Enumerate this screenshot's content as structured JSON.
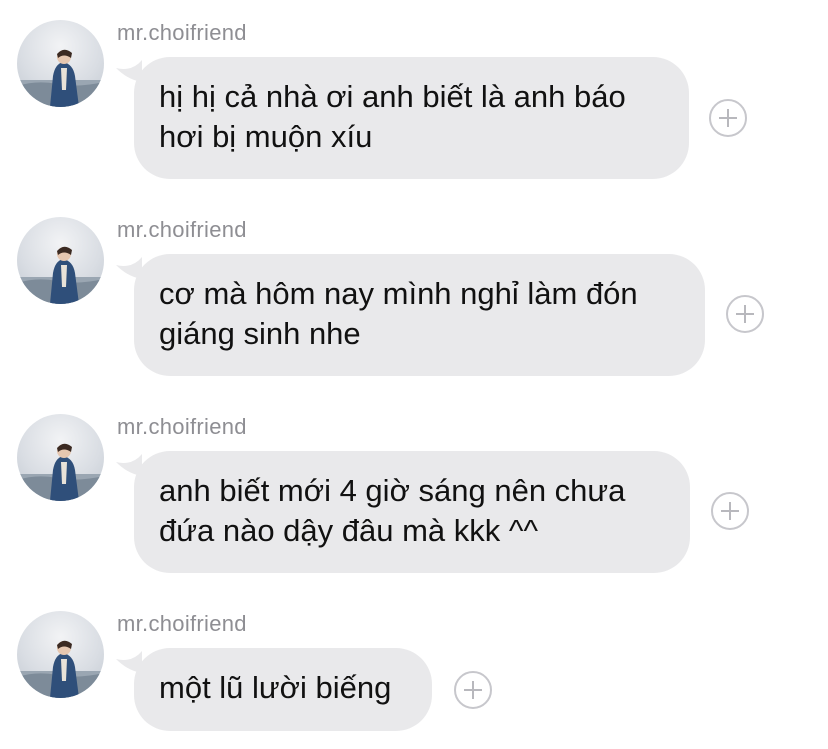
{
  "messages": [
    {
      "sender": "mr.choifriend",
      "lines": [
        "hị hị cả nhà ơi anh biết là anh báo",
        "hơi bị muộn xíu"
      ]
    },
    {
      "sender": "mr.choifriend",
      "lines": [
        "cơ mà hôm nay mình nghỉ làm đón",
        "giáng sinh nhe"
      ]
    },
    {
      "sender": "mr.choifriend",
      "lines": [
        "anh biết mới 4 giờ sáng nên chưa",
        "đứa nào dậy đâu mà kkk ^^"
      ]
    },
    {
      "sender": "mr.choifriend",
      "lines": [
        "một lũ lười biếng"
      ]
    }
  ],
  "icons": {
    "avatar": "avatar-photo",
    "reaction": "add-reaction-plus-icon"
  },
  "colors": {
    "bubble": "#e9e9eb",
    "sender": "#8e8e93",
    "text": "#111111",
    "plus": "#c7c7cc"
  }
}
